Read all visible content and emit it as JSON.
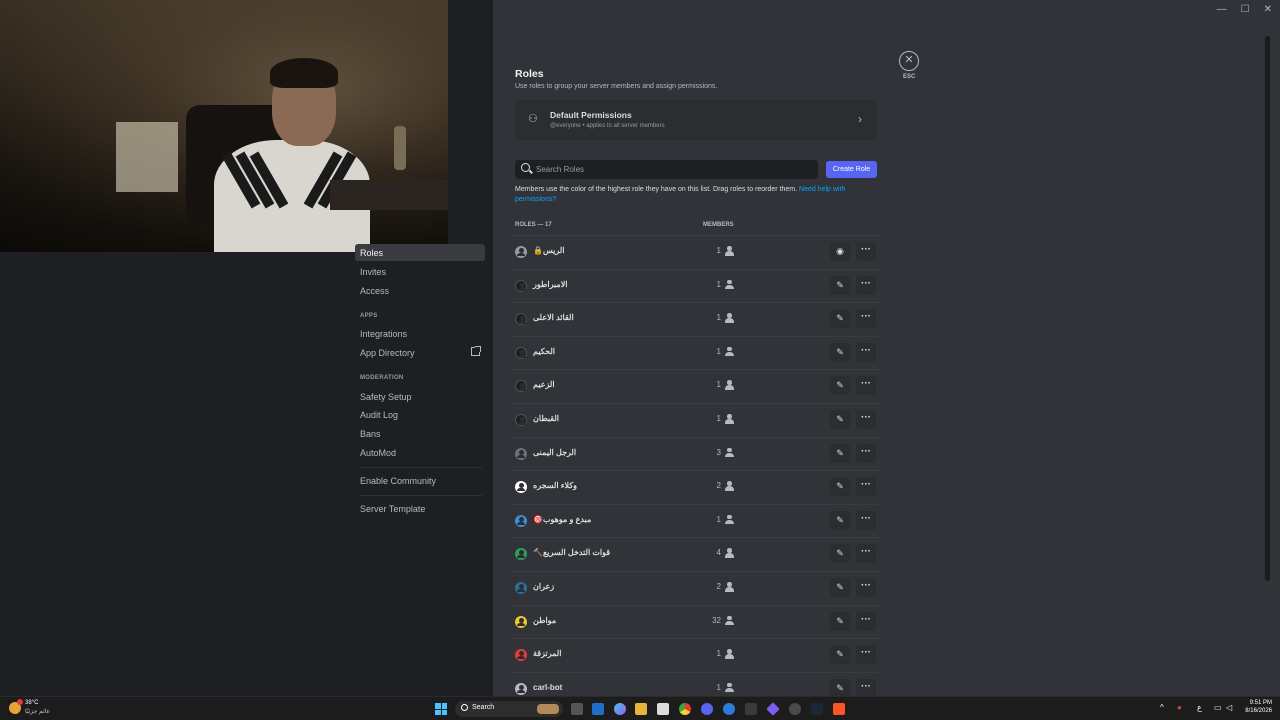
{
  "window_controls": {
    "minimize": "—",
    "maximize": "☐",
    "close": "✕"
  },
  "sidebar": {
    "active_item": "Roles",
    "items_top": [
      "Invites",
      "Access"
    ],
    "apps_header": "APPS",
    "apps_items": [
      "Integrations",
      "App Directory"
    ],
    "moderation_header": "MODERATION",
    "moderation_items": [
      "Safety Setup",
      "Audit Log",
      "Bans",
      "AutoMod"
    ],
    "enable_community": "Enable Community",
    "server_template": "Server Template"
  },
  "header": {
    "title": "Roles",
    "subtitle": "Use roles to group your server members and assign permissions.",
    "close_label": "ESC"
  },
  "default_permissions": {
    "title": "Default Permissions",
    "subtitle": "@everyone • applies to all server members"
  },
  "search": {
    "placeholder": "Search Roles"
  },
  "create_role_label": "Create Role",
  "hint": {
    "text": "Members use the color of the highest role they have on this list. Drag roles to reorder them. ",
    "link": "Need help with permissions?"
  },
  "columns": {
    "roles": "ROLES — 17",
    "members": "MEMBERS"
  },
  "roles": [
    {
      "name": "🔒الريس",
      "count": "1",
      "color": "#949ba4",
      "action": "view"
    },
    {
      "name": "الامبراطور",
      "count": "1",
      "color": "#1e1f22",
      "action": "edit"
    },
    {
      "name": "القائد الاعلى",
      "count": "1",
      "color": "#1e1f22",
      "action": "edit"
    },
    {
      "name": "الحكيم",
      "count": "1",
      "color": "#1e1f22",
      "action": "edit"
    },
    {
      "name": "الزعيم",
      "count": "1",
      "color": "#1e1f22",
      "action": "edit"
    },
    {
      "name": "القبطان",
      "count": "1",
      "color": "#1e1f22",
      "action": "edit"
    },
    {
      "name": "الرجل اليمنى",
      "count": "3",
      "color": "#6b7280",
      "action": "edit"
    },
    {
      "name": "وكلاء السجره",
      "count": "2",
      "color": "#ffffff",
      "action": "edit"
    },
    {
      "name": "🎯مبدع و موهوب",
      "count": "1",
      "color": "#3b8fd9",
      "action": "edit"
    },
    {
      "name": "🔨قوات التدخل السريع",
      "count": "4",
      "color": "#2f9e57",
      "action": "edit"
    },
    {
      "name": "زعران",
      "count": "2",
      "color": "#2a6d9e",
      "action": "edit"
    },
    {
      "name": "مواطن",
      "count": "32",
      "color": "#f0c52e",
      "action": "edit"
    },
    {
      "name": "المرتزقة",
      "count": "1",
      "color": "#e23b3b",
      "action": "edit"
    },
    {
      "name": "carl-bot",
      "count": "1",
      "color": "#b5bac1",
      "action": "edit"
    }
  ],
  "taskbar": {
    "weather_temp": "38°C",
    "weather_desc": "غائم جزئيًا",
    "search_label": "Search",
    "time": "9:51 PM",
    "date": "8/16/2026",
    "lang": "ع"
  }
}
